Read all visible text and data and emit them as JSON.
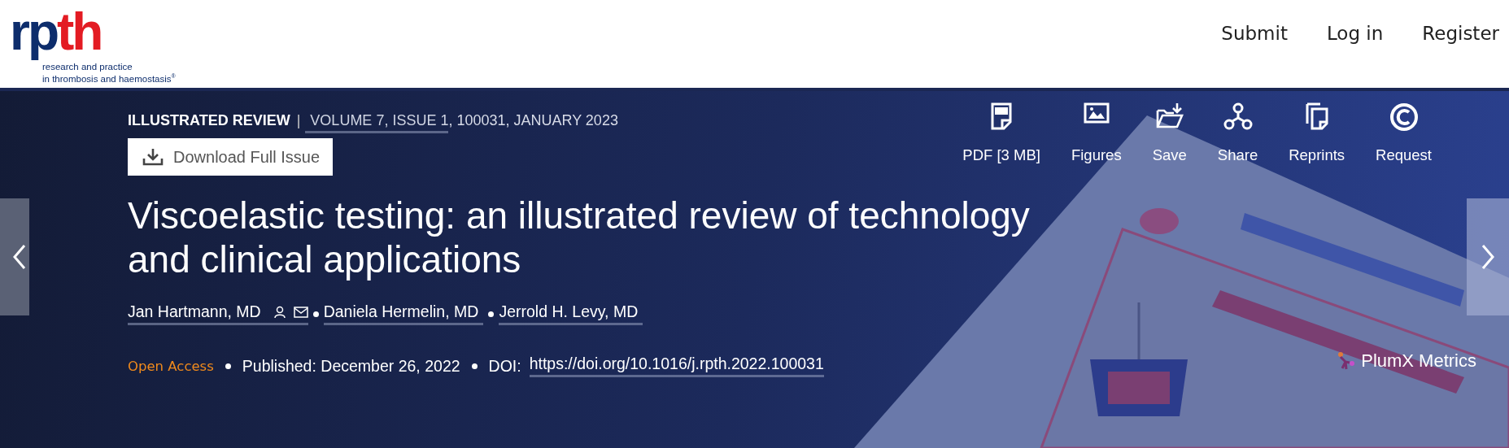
{
  "header": {
    "logo": {
      "mark_left": "rp",
      "mark_right": "th",
      "tagline": [
        "research and practice",
        "in thrombosis and haemostasis$^{®}$"
      ]
    },
    "nav": [
      "Submit",
      "Log in",
      "Register"
    ]
  },
  "banner": {
    "article_type": "ILLUSTRATED REVIEW",
    "separator": "|",
    "issue_link": "VOLUME 7, ISSUE 1",
    "issue_rest": ", 100031, JANUARY 2023",
    "download_button": "Download Full Issue",
    "toolbar": [
      {
        "kind": "pdf",
        "label": "PDF [3 MB]"
      },
      {
        "kind": "figures",
        "label": "Figures"
      },
      {
        "kind": "save",
        "label": "Save"
      },
      {
        "kind": "share",
        "label": "Share"
      },
      {
        "kind": "reprints",
        "label": "Reprints"
      },
      {
        "kind": "request",
        "label": "Request"
      }
    ],
    "title": "Viscoelastic testing: an illustrated review of technology and clinical applications",
    "authors": [
      {
        "name": "Jan Hartmann, MD",
        "contact_icons": true
      },
      {
        "name": "Daniela Hermelin, MD",
        "contact_icons": false
      },
      {
        "name": "Jerrold H. Levy, MD",
        "contact_icons": false
      }
    ],
    "access": "Open Access",
    "published": "Published: December 26, 2022",
    "doi_label": "DOI:",
    "doi_link": "https://doi.org/10.1016/j.rpth.2022.100031",
    "plumx": "PlumX Metrics"
  }
}
